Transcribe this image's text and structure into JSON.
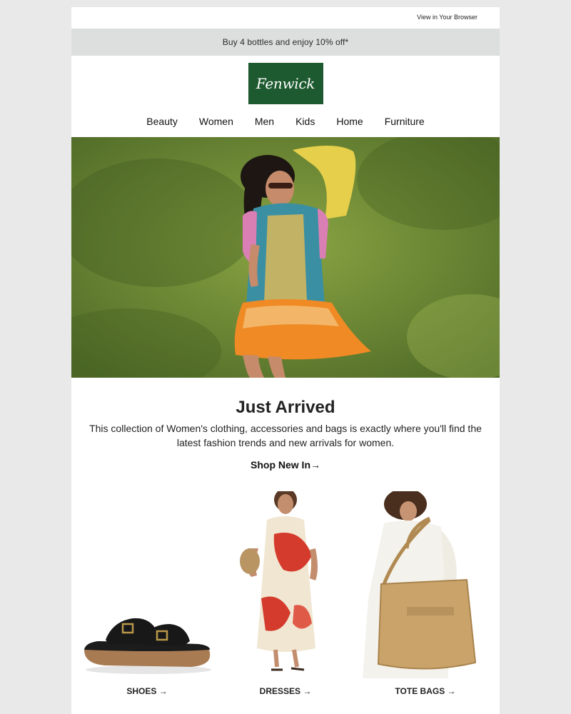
{
  "header": {
    "view_in_browser": "View in Your Browser",
    "promo": "Buy 4 bottles and enjoy 10% off*",
    "logo_text": "Fenwick"
  },
  "nav": {
    "items": [
      {
        "label": "Beauty"
      },
      {
        "label": "Women"
      },
      {
        "label": "Men"
      },
      {
        "label": "Kids"
      },
      {
        "label": "Home"
      },
      {
        "label": "Furniture"
      }
    ]
  },
  "hero": {
    "alt": "Woman in a colourful printed dress lying on grass"
  },
  "intro": {
    "headline": "Just Arrived",
    "description": "This collection of Women's clothing, accessories and bags is exactly where you'll find the latest fashion trends and new arrivals for women.",
    "cta": "Shop New In→"
  },
  "products": [
    {
      "label": "SHOES →"
    },
    {
      "label": "DRESSES →"
    },
    {
      "label": "TOTE BAGS →"
    }
  ],
  "colors": {
    "page_bg": "#e9e9e9",
    "promo_bg": "#dcdfdd",
    "logo_bg": "#1e5a2f",
    "grass": "#6a8a36"
  }
}
